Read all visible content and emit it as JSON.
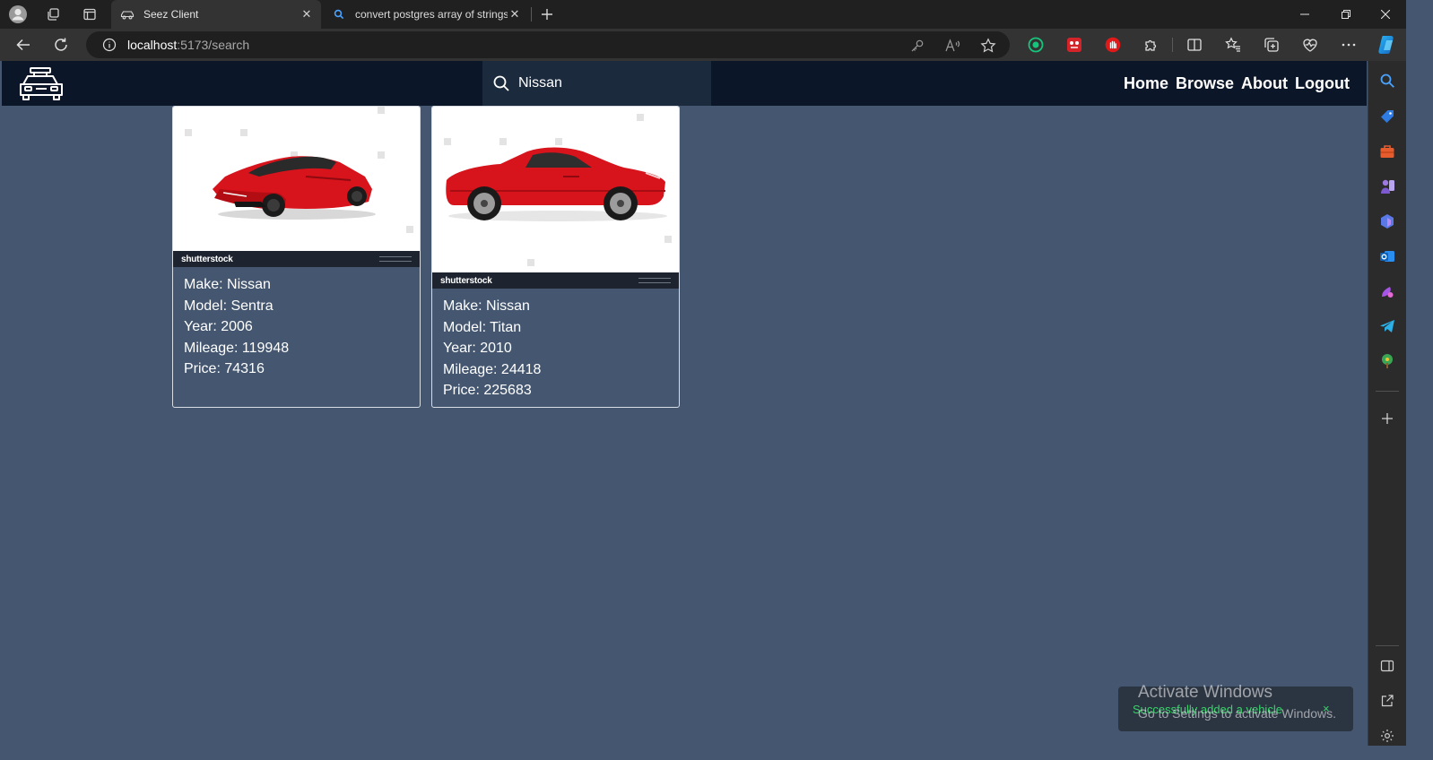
{
  "browser": {
    "tabs": [
      {
        "title": "Seez Client",
        "active": true
      },
      {
        "title": "convert postgres array of strings",
        "active": false
      }
    ],
    "url_host": "localhost",
    "url_path": ":5173/search"
  },
  "site": {
    "search_value": "Nissan",
    "nav": [
      "Home",
      "Browse",
      "About",
      "Logout"
    ]
  },
  "vehicles": [
    {
      "image_brand": "shutterstock",
      "make": "Make: Nissan",
      "model": "Model: Sentra",
      "year": "Year: 2006",
      "mileage": "Mileage: 119948",
      "price": "Price: 74316"
    },
    {
      "image_brand": "shutterstock",
      "make": "Make: Nissan",
      "model": "Model: Titan",
      "year": "Year: 2010",
      "mileage": "Mileage: 24418",
      "price": "Price: 225683"
    }
  ],
  "toast": {
    "message": "Successfully added a vehicle",
    "close": "×"
  },
  "watermark": {
    "line1": "Activate Windows",
    "line2": "Go to Settings to activate Windows."
  },
  "colors": {
    "nav_bg": "#0b1628",
    "page_bg": "#455770",
    "toast_text": "#3bd36c",
    "car_red": "#d7131c"
  }
}
